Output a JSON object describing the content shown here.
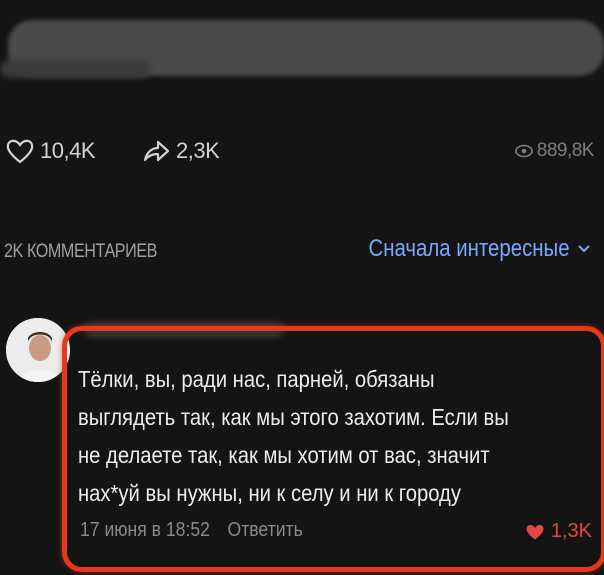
{
  "post": {
    "likes": "10,4K",
    "shares": "2,3K",
    "views": "889,8K"
  },
  "comments": {
    "count_label": "2K КОММЕНТАРИЕВ",
    "sort_label": "Сначала интересные"
  },
  "comment": {
    "lines": [
      "Тёлки, вы, ради нас, парней, обязаны",
      "выглядеть так, как мы этого захотим. Если вы",
      "не делаете так, как мы хотим от вас, значит",
      "нах*уй вы нужны, ни к селу и ни к городу"
    ],
    "date": "17 июня в 18:52",
    "reply_label": "Ответить",
    "likes": "1,3K"
  },
  "colors": {
    "accent_blue": "#7aa7ff",
    "highlight_red": "#e5381d",
    "like_red": "#e64646"
  },
  "icons": {
    "like": "heart-outline-icon",
    "share": "share-arrow-icon",
    "views": "eye-icon",
    "sort": "chevron-down-icon",
    "comment_like": "heart-filled-icon"
  }
}
